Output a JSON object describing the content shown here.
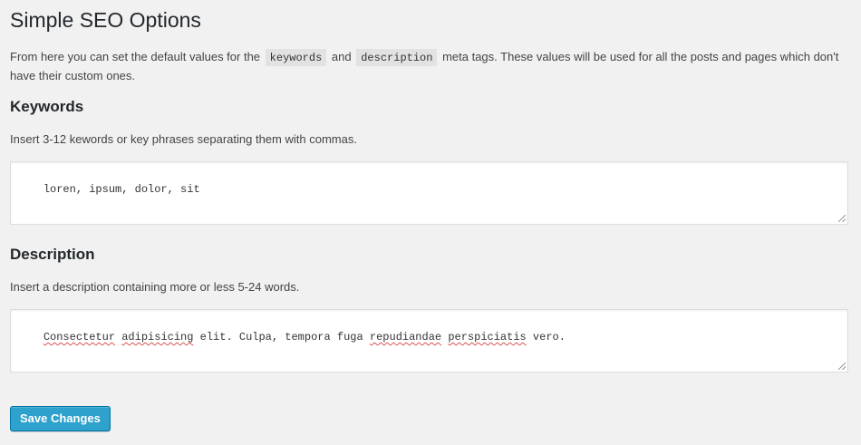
{
  "page": {
    "title": "Simple SEO Options"
  },
  "intro": {
    "text_before": "From here you can set the default values for the",
    "tag_keywords": "keywords",
    "text_and": "and",
    "tag_description": "description",
    "text_after": "meta tags. These values will be used for all the posts and pages which don't have their custom ones."
  },
  "keywords": {
    "heading": "Keywords",
    "help": "Insert 3-12 kewords or key phrases separating them with commas.",
    "value": "loren, ipsum, dolor, sit"
  },
  "description": {
    "heading": "Description",
    "help": "Insert a description containing more or less 5-24 words.",
    "value_parts": [
      {
        "text": "Consectetur",
        "spell": true
      },
      {
        "text": " ",
        "spell": false
      },
      {
        "text": "adipisicing",
        "spell": true
      },
      {
        "text": " elit. Culpa, tempora fuga ",
        "spell": false
      },
      {
        "text": "repudiandae",
        "spell": true
      },
      {
        "text": " ",
        "spell": false
      },
      {
        "text": "perspiciatis",
        "spell": true
      },
      {
        "text": " vero.",
        "spell": false
      }
    ]
  },
  "actions": {
    "save_label": "Save Changes"
  },
  "colors": {
    "background": "#f1f1f1",
    "button": "#2ea2cc",
    "spellcheck_underline": "#d9534f"
  }
}
